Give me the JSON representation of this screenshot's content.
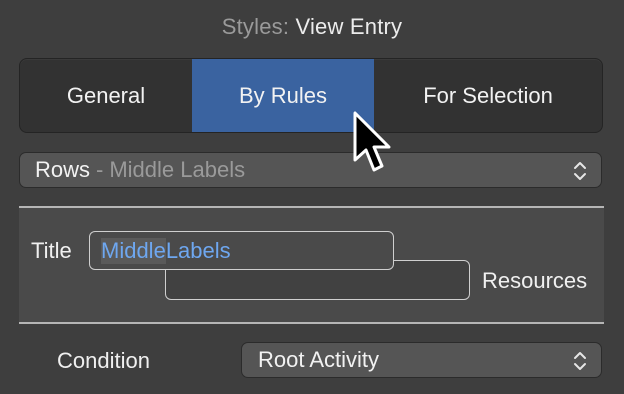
{
  "header": {
    "prefix": "Styles:",
    "title": "View Entry"
  },
  "tabs": {
    "items": [
      {
        "label": "General"
      },
      {
        "label": "By Rules",
        "selected": true
      },
      {
        "label": "For Selection"
      }
    ],
    "selected_color": "#3a63a0"
  },
  "rows_popup": {
    "main": "Rows",
    "separator": "-",
    "sub": "Middle Labels",
    "icon": "up-down-chevron-icon"
  },
  "title_field": {
    "label": "Title",
    "value_part1": "Middle",
    "value_part2": " Labels",
    "text_color": "#6ea7f0"
  },
  "resources_field": {
    "label": "Resources",
    "value": ""
  },
  "condition": {
    "label": "Condition",
    "value": "Root Activity",
    "icon": "up-down-chevron-icon"
  },
  "cursor": {
    "icon": "arrow-cursor-icon"
  }
}
